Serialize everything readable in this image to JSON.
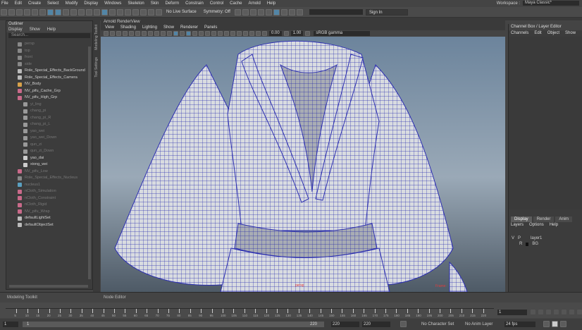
{
  "menubar": {
    "items": [
      "File",
      "Edit",
      "Create",
      "Select",
      "Modify",
      "Display",
      "Windows",
      "Skeleton",
      "Skin",
      "Deform",
      "Constrain",
      "Control",
      "Cache",
      "Arnold",
      "Help"
    ],
    "workspace_label": "Workspace :",
    "workspace_value": "Maya Classic*"
  },
  "statusline": {
    "live_surface": "No Live Surface",
    "symmetry": "Symmetry: Off",
    "signin": "Sign In"
  },
  "outliner": {
    "title": "Outliner",
    "menu": [
      "Display",
      "Show",
      "Help"
    ],
    "search_placeholder": "Search...",
    "items": [
      {
        "label": "persp",
        "dim": true,
        "color": "#888"
      },
      {
        "label": "top",
        "dim": true,
        "color": "#888"
      },
      {
        "label": "front",
        "dim": true,
        "color": "#888"
      },
      {
        "label": "side",
        "dim": true,
        "color": "#888"
      },
      {
        "label": "Role_Special_Effects_BackGround",
        "dim": false,
        "color": "#bbb"
      },
      {
        "label": "Role_Special_Effects_Camera",
        "dim": false,
        "color": "#bbb"
      },
      {
        "label": "NV_Body",
        "dim": false,
        "color": "#d8a24a"
      },
      {
        "label": "NV_pifu_Cache_Grp",
        "dim": false,
        "color": "#c96a8a"
      },
      {
        "label": "NV_pifu_High_Grp",
        "dim": false,
        "color": "#c96a8a"
      },
      {
        "label": "yi_ling",
        "dim": true,
        "color": "#999"
      },
      {
        "label": "chang_pi",
        "dim": true,
        "color": "#999"
      },
      {
        "label": "chang_pi_R",
        "dim": true,
        "color": "#999"
      },
      {
        "label": "chang_pi_L",
        "dim": true,
        "color": "#999"
      },
      {
        "label": "yao_wei",
        "dim": true,
        "color": "#999"
      },
      {
        "label": "yao_wei_Down",
        "dim": true,
        "color": "#999"
      },
      {
        "label": "qun_zi",
        "dim": true,
        "color": "#999"
      },
      {
        "label": "qun_zi_Down",
        "dim": true,
        "color": "#999"
      },
      {
        "label": "yao_dai",
        "dim": false,
        "color": "#ccc"
      },
      {
        "label": "xiong_wei",
        "dim": false,
        "color": "#ccc"
      },
      {
        "label": "NV_pifu_Low",
        "dim": true,
        "color": "#c96a8a"
      },
      {
        "label": "Role_Special_Effects_Nucleus",
        "dim": true,
        "color": "#888"
      },
      {
        "label": "nucleus1",
        "dim": true,
        "color": "#5aa0c0"
      },
      {
        "label": "nCloth_Simulation",
        "dim": true,
        "color": "#c96a8a"
      },
      {
        "label": "nCloth_Constraint",
        "dim": true,
        "color": "#c96a8a"
      },
      {
        "label": "nCloth_Rigid",
        "dim": true,
        "color": "#c96a8a"
      },
      {
        "label": "NV_pifu_Wrap",
        "dim": true,
        "color": "#c96a8a"
      },
      {
        "label": "defaultLightSet",
        "dim": false,
        "color": "#bbb"
      },
      {
        "label": "defaultObjectSet",
        "dim": false,
        "color": "#bbb"
      }
    ]
  },
  "side_labels": {
    "left": "Modeling Toolkit",
    "right": "Tool Settings"
  },
  "viewport": {
    "title": "Arnold RenderView",
    "menu": [
      "View",
      "Shading",
      "Lighting",
      "Show",
      "Renderer",
      "Panels"
    ],
    "exposure": "0.00",
    "gamma": "1.00",
    "colorspace": "sRGB gamma",
    "hud_frame_label": "Frame:",
    "hud_center": "persp"
  },
  "rightpanel": {
    "title": "Channel Box / Layer Editor",
    "menu": [
      "Channels",
      "Edit",
      "Object",
      "Show"
    ],
    "tabs": [
      "Display",
      "Render",
      "Anim"
    ],
    "layer_menu": [
      "Layers",
      "Options",
      "Help"
    ],
    "layers": [
      {
        "v": "V",
        "p": "P",
        "name": "layer1"
      },
      {
        "v": "",
        "p": "R",
        "name": "BG"
      }
    ]
  },
  "bottom": {
    "left_label": "Modeling Toolkit",
    "mid_label": "Node Editor"
  },
  "timeline": {
    "current_frame": "1",
    "ticks": [
      "5",
      "10",
      "15",
      "20",
      "25",
      "30",
      "35",
      "40",
      "45",
      "50",
      "55",
      "60",
      "65",
      "70",
      "75",
      "80",
      "85",
      "90",
      "95",
      "100",
      "105",
      "110",
      "115",
      "120",
      "125",
      "130",
      "135",
      "140",
      "145",
      "150",
      "155",
      "160",
      "165",
      "170",
      "175",
      "180",
      "185",
      "190",
      "195",
      "200",
      "205",
      "210",
      "215",
      "220"
    ]
  },
  "range": {
    "start": "1",
    "inner_start": "1",
    "inner_end": "220",
    "end_a": "220",
    "end_b": "220",
    "character_set": "No Character Set",
    "anim_layer": "No Anim Layer",
    "fps": "24 fps"
  }
}
